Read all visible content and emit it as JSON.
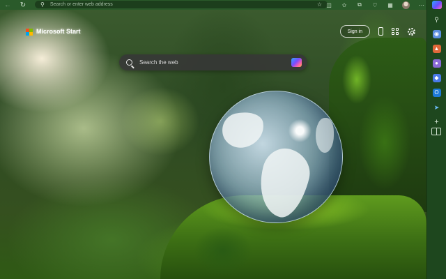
{
  "toolbar": {
    "address_placeholder": "Search or enter web address"
  },
  "page": {
    "brand": "Microsoft Start",
    "signin_label": "Sign in",
    "search_placeholder": "Search the web"
  },
  "sidebar": {
    "items": [
      "search-icon",
      "tag-icon",
      "shopping-bag-icon",
      "people-icon",
      "games-icon",
      "outlook-icon",
      "send-icon",
      "add-icon"
    ]
  }
}
